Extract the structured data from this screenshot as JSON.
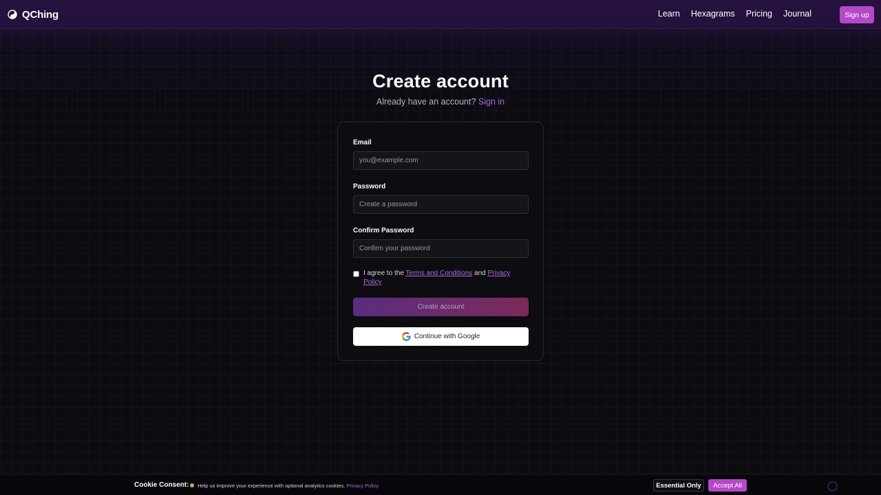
{
  "header": {
    "logo_text": "QChing",
    "nav": [
      {
        "label": "Learn"
      },
      {
        "label": "Hexagrams"
      },
      {
        "label": "Pricing"
      },
      {
        "label": "Journal"
      }
    ],
    "signup_label": "Sign up"
  },
  "page": {
    "title": "Create account",
    "subtitle_prefix": "Already have an account?",
    "signin_link": "Sign in"
  },
  "form": {
    "email_label": "Email",
    "email_placeholder": "you@example.com",
    "email_value": "",
    "password_label": "Password",
    "password_placeholder": "Create a password",
    "password_value": "",
    "confirm_label": "Confirm Password",
    "confirm_placeholder": "Confirm your password",
    "confirm_value": "",
    "agree_prefix": "I agree to the",
    "terms_link": "Terms and Conditions",
    "agree_and": "and",
    "privacy_link": "Privacy Policy",
    "agree_checked": false,
    "create_label": "Create account",
    "google_label": "Continue with Google"
  },
  "cookie": {
    "title": "Cookie Consent:",
    "text": "Help us improve your experience with optional analytics cookies.",
    "privacy_link": "Privacy Policy",
    "essential_label": "Essential Only",
    "accept_label": "Accept All"
  },
  "colors": {
    "accent": "#b548c8",
    "link": "#b06ae0",
    "header_bg": "#26123e",
    "page_bg": "#0b0b10"
  }
}
